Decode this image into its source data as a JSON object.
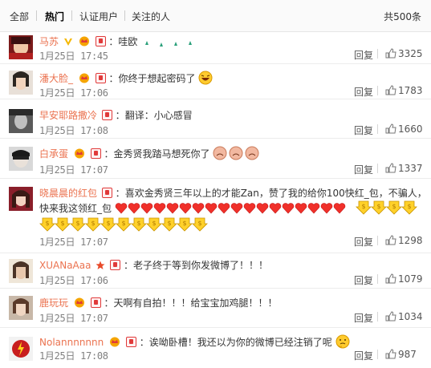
{
  "tabs": {
    "all": "全部",
    "hot": "热门",
    "verified": "认证用户",
    "following": "关注的人",
    "total": "共500条"
  },
  "actions": {
    "reply": "回复"
  },
  "colors": {
    "username": "#eb7350",
    "meta": "#808080",
    "accent_red": "#e03a3a"
  },
  "comments": [
    {
      "user": "马苏",
      "text": "哇欧",
      "time": "1月25日 17:45",
      "likes": "3325",
      "badges": [
        "vip-crown-icon",
        "member-badge-icon",
        "verified-v-icon"
      ],
      "trailing_emoji": "sparkles"
    },
    {
      "user": "潘大脸_",
      "text": "你终于想起密码了",
      "time": "1月25日 17:06",
      "likes": "1783",
      "badges": [
        "vip-crown-icon",
        "member-badge-icon"
      ],
      "trailing_emoji": "laughing-face"
    },
    {
      "user": "早安耶路撒冷",
      "text": "翻译：小心感冒",
      "time": "1月25日 17:08",
      "likes": "1660",
      "badges": [
        "member-badge-icon"
      ]
    },
    {
      "user": "白承蛋",
      "text": "金秀贤我踏马想死你了",
      "time": "1月25日 17:07",
      "likes": "1337",
      "badges": [
        "vip-crown-icon",
        "member-badge-icon"
      ],
      "trailing_emoji": "crying-faces"
    },
    {
      "user": "晓晨晨的红包",
      "text": "喜欢金秀贤三年以上的才能Zan，赞了我的给你100快红_包，不骗人，",
      "text2": "快来我这领红_包",
      "time": "1月25日 17:07",
      "likes": "1298",
      "badges": [
        "member-badge-icon"
      ],
      "trailing_emoji": "hearts-and-coins"
    },
    {
      "user": "XUANaAaa",
      "text": "老子终于等到你发微博了！！！",
      "time": "1月25日 17:06",
      "likes": "1079",
      "badges": [
        "star-icon",
        "member-badge-icon"
      ]
    },
    {
      "user": "鹿玩玩",
      "text": "天啊有自拍！！！给宝宝加鸡腿！！！",
      "time": "1月25日 17:07",
      "likes": "1034",
      "badges": [
        "vip-crown-icon",
        "member-badge-icon"
      ]
    },
    {
      "user": "Nolannnnnnn",
      "text": "诶呦卧槽！我还以为你的微博已经注销了呢",
      "time": "1月25日 17:08",
      "likes": "987",
      "badges": [
        "vip-crown-icon",
        "member-badge-icon"
      ],
      "trailing_emoji": "thinking-face"
    }
  ]
}
